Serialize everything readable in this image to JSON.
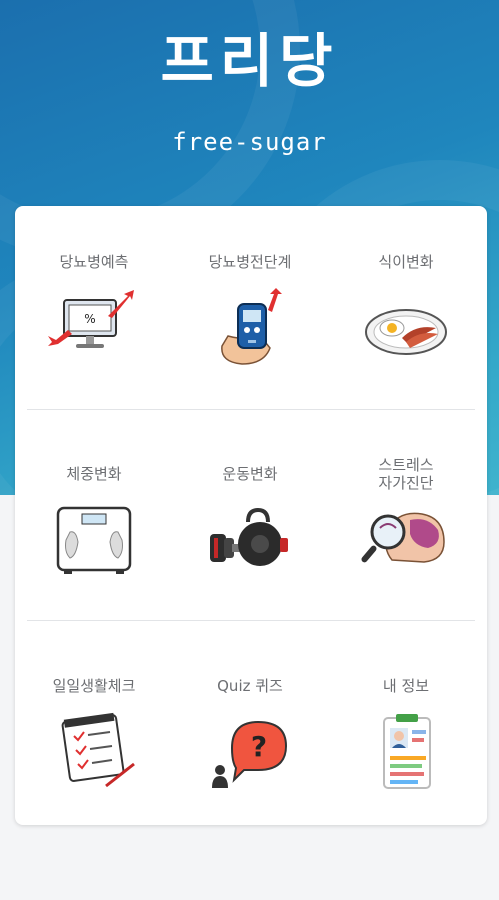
{
  "header": {
    "title": "프리당",
    "subtitle": "free-sugar"
  },
  "colors": {
    "header_gradient_start": "#1b6fae",
    "header_gradient_end": "#3fb3cd",
    "card_background": "#ffffff",
    "label_text": "#6d6f73"
  },
  "menu": {
    "items": [
      {
        "label": "당뇨병예측",
        "icon": "monitor-percent-icon"
      },
      {
        "label": "당뇨병전단계",
        "icon": "glucose-meter-icon"
      },
      {
        "label": "식이변화",
        "icon": "meal-plate-icon"
      },
      {
        "label": "체중변화",
        "icon": "bathroom-scale-icon"
      },
      {
        "label": "운동변화",
        "icon": "dumbbell-icon"
      },
      {
        "label": "스트레스\n자가진단",
        "icon": "magnifier-brain-icon"
      },
      {
        "label": "일일생활체크",
        "icon": "checklist-icon"
      },
      {
        "label": "Quiz 퀴즈",
        "icon": "question-bubble-icon"
      },
      {
        "label": "내 정보",
        "icon": "id-card-icon"
      }
    ]
  }
}
